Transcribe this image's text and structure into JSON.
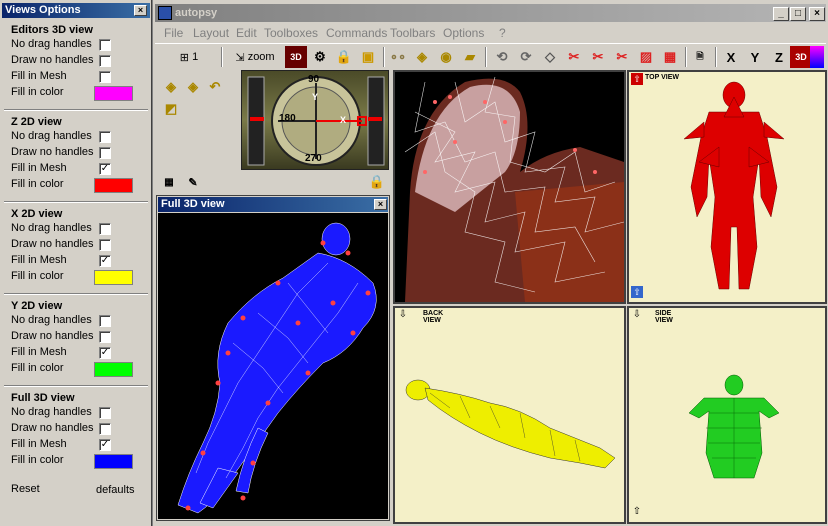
{
  "views_options": {
    "title": "Views Options",
    "sections": [
      {
        "title": "Editors 3D view",
        "no_drag": "No drag handles",
        "draw_no": "Draw no handles",
        "fill_mesh": "Fill in Mesh",
        "fill_color": "Fill in color",
        "color": "#ff00ff",
        "checked": [
          false,
          false,
          false
        ]
      },
      {
        "title": "Z 2D view",
        "no_drag": "No drag handles",
        "draw_no": "Draw no handles",
        "fill_mesh": "Fill in Mesh",
        "fill_color": "Fill in color",
        "color": "#ff0000",
        "checked": [
          false,
          false,
          true
        ]
      },
      {
        "title": "X 2D view",
        "no_drag": "No drag handles",
        "draw_no": "Draw no handles",
        "fill_mesh": "Fill in Mesh",
        "fill_color": "Fill in color",
        "color": "#ffff00",
        "checked": [
          false,
          false,
          true
        ]
      },
      {
        "title": "Y 2D view",
        "no_drag": "No drag handles",
        "draw_no": "Draw no handles",
        "fill_mesh": "Fill in Mesh",
        "fill_color": "Fill in color",
        "color": "#00ff00",
        "checked": [
          false,
          false,
          true
        ]
      },
      {
        "title": "Full 3D view",
        "no_drag": "No drag handles",
        "draw_no": "Draw no handles",
        "fill_mesh": "Fill in Mesh",
        "fill_color": "Fill in color",
        "color": "#0000ff",
        "checked": [
          false,
          false,
          true
        ]
      }
    ],
    "reset": "Reset",
    "defaults": "defaults"
  },
  "window": {
    "title": "autopsy"
  },
  "menu": [
    "File",
    "Layout",
    "Edit",
    "Toolboxes",
    "Commands",
    "Toolbars",
    "Options",
    "?"
  ],
  "toolbar": {
    "step": "1",
    "zoom": "zoom",
    "btn_3d": "3D",
    "x": "X",
    "y": "Y",
    "z": "Z"
  },
  "compass": {
    "north": "90",
    "east": "180",
    "south": "270",
    "y": "Y",
    "x": "X"
  },
  "full3d": {
    "title": "Full 3D view"
  },
  "views": {
    "top": "TOP VIEW",
    "back": "BACK VIEW",
    "side": "SIDE VIEW"
  },
  "colors": {
    "titlebar": "#0a246a",
    "inactive": "#808080"
  }
}
